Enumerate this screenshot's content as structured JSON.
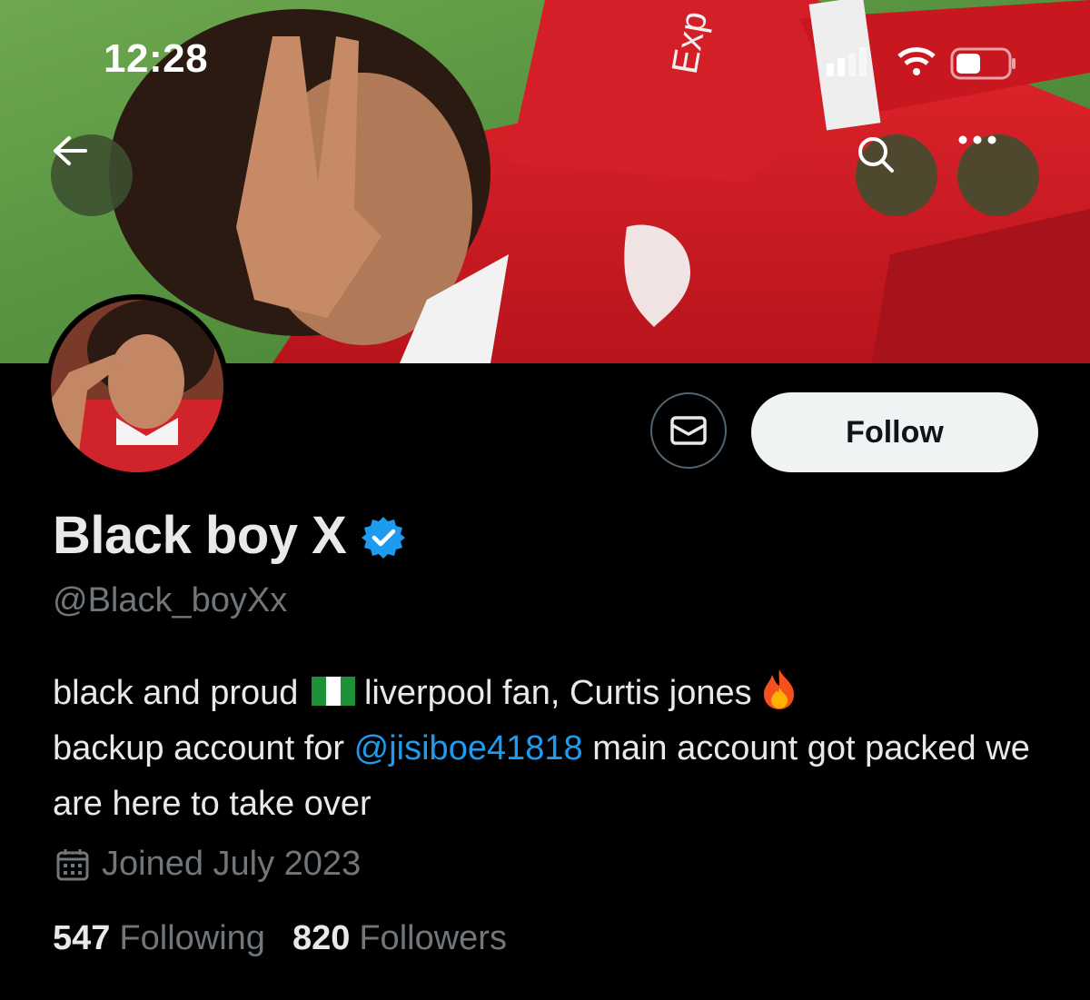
{
  "status_bar": {
    "time": "12:28"
  },
  "header": {
    "icons": [
      "back-arrow-icon",
      "search-icon",
      "more-icon"
    ]
  },
  "profile": {
    "display_name": "Black boy X",
    "verified": true,
    "handle": "@Black_boyXx",
    "bio": {
      "part1": "black and proud",
      "part2": "liverpool fan, Curtis jones",
      "part3": "backup account for",
      "mention": "@jisiboe41818",
      "part4": "main account got packed we are here to take over"
    },
    "joined": "Joined July 2023",
    "following_count": "547",
    "following_label": "Following",
    "followers_count": "820",
    "followers_label": "Followers"
  },
  "actions": {
    "follow_label": "Follow"
  },
  "colors": {
    "background": "#000000",
    "accent": "#1d9bf0",
    "secondary_text": "#71767b",
    "follow_button_bg": "#eff3f4"
  }
}
